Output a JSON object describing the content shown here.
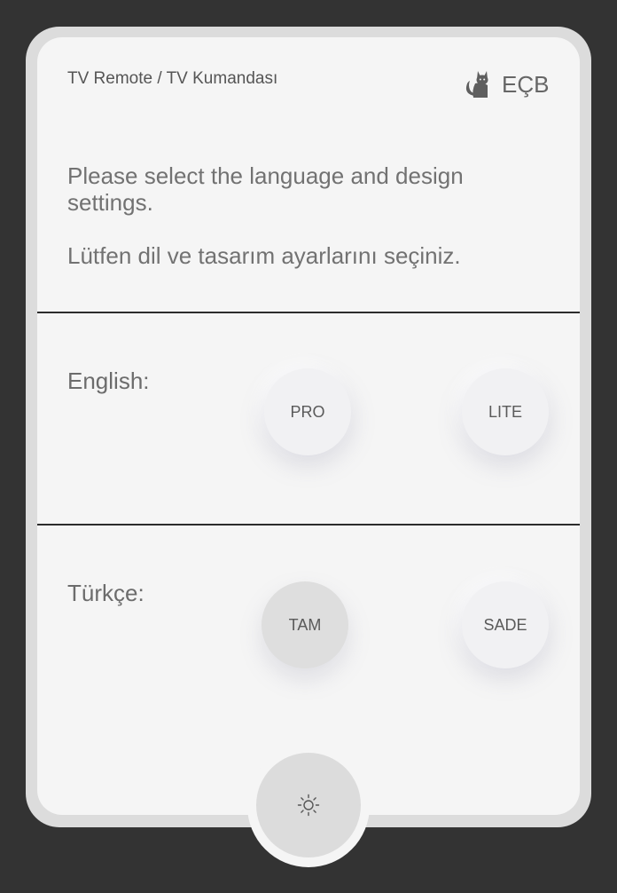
{
  "header": {
    "title": "TV Remote / TV Kumandası",
    "brand_text": "EÇB",
    "brand_icon": "cat-icon"
  },
  "intro": {
    "english": "Please select the language and design settings.",
    "turkish": "Lütfen dil ve tasarım ayarlarını seçiniz."
  },
  "languages": [
    {
      "label": "English:",
      "options": [
        "PRO",
        "LITE"
      ]
    },
    {
      "label": "Türkçe:",
      "options": [
        "TAM",
        "SADE"
      ],
      "selected": "TAM"
    }
  ],
  "theme_toggle": {
    "icon": "sun-icon"
  },
  "colors": {
    "background": "#333333",
    "frame": "#dcdcdc",
    "screen": "#f5f5f5",
    "button": "#f1f1f3",
    "button_pressed": "#dedede",
    "divider": "#2c2c2c"
  }
}
